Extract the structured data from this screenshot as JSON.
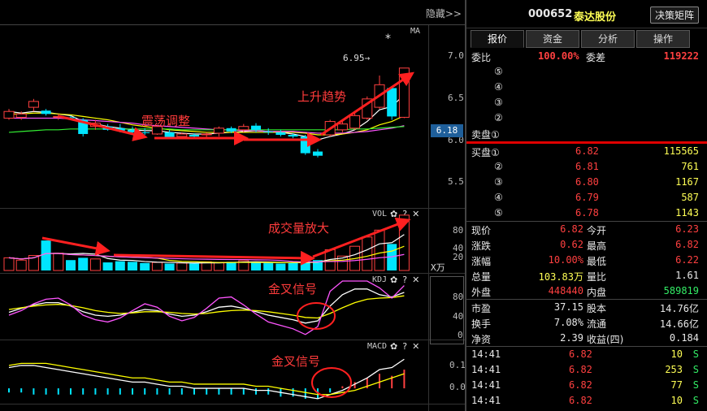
{
  "toolbar": {
    "hide_label": "隐藏>>"
  },
  "main_chart": {
    "ma_label": "MA",
    "star_mark": "*",
    "high_label": "6.95→",
    "price_axis": [
      "7.0",
      "6.5",
      "6.0",
      "5.5"
    ],
    "current_price": "6.18",
    "annotations": {
      "consolidation": "震荡调整",
      "uptrend": "上升趋势"
    }
  },
  "volume_pane": {
    "title": "VOL",
    "axis": [
      "80",
      "40",
      "20"
    ],
    "unit": "X万",
    "annotation": "成交量放大"
  },
  "kdj_pane": {
    "title": "KDJ",
    "axis": [
      "80",
      "40",
      "0"
    ],
    "annotation": "金叉信号"
  },
  "macd_pane": {
    "title": "MACD",
    "axis": [
      "0.1",
      "0.0"
    ],
    "annotation": "金叉信号"
  },
  "pane_icons": {
    "settings": "✿",
    "help": "?",
    "close": "✕"
  },
  "quote": {
    "code": "000652",
    "name": "泰达股份",
    "decision_button": "决策矩阵",
    "tabs": [
      "报价",
      "资金",
      "分析",
      "操作"
    ],
    "weibi_label": "委比",
    "weibi_value": "100.00%",
    "weicha_label": "委差",
    "weicha_value": "119222",
    "sell_levels": [
      {
        "label": "⑤"
      },
      {
        "label": "④"
      },
      {
        "label": "③"
      },
      {
        "label": "②"
      },
      {
        "label": "卖盘①"
      }
    ],
    "buy_levels": [
      {
        "label": "买盘①",
        "price": "6.82",
        "volume": "115565"
      },
      {
        "label": "②",
        "price": "6.81",
        "volume": "761"
      },
      {
        "label": "③",
        "price": "6.80",
        "volume": "1167"
      },
      {
        "label": "④",
        "price": "6.79",
        "volume": "587"
      },
      {
        "label": "⑤",
        "price": "6.78",
        "volume": "1143"
      }
    ],
    "stats": [
      {
        "l1": "现价",
        "v1": "6.82",
        "c1": "red",
        "l2": "今开",
        "v2": "6.23",
        "c2": "red"
      },
      {
        "l1": "涨跌",
        "v1": "0.62",
        "c1": "red",
        "l2": "最高",
        "v2": "6.82",
        "c2": "red"
      },
      {
        "l1": "涨幅",
        "v1": "10.00%",
        "c1": "red",
        "l2": "最低",
        "v2": "6.22",
        "c2": "red"
      },
      {
        "l1": "总量",
        "v1": "103.83万",
        "c1": "yellow",
        "l2": "量比",
        "v2": "1.61",
        "c2": "white"
      },
      {
        "l1": "外盘",
        "v1": "448440",
        "c1": "red",
        "l2": "内盘",
        "v2": "589819",
        "c2": "green"
      },
      {
        "l1": "市盈",
        "v1": "37.15",
        "c1": "white",
        "l2": "股本",
        "v2": "14.76亿",
        "c2": "white"
      },
      {
        "l1": "换手",
        "v1": "7.08%",
        "c1": "white",
        "l2": "流通",
        "v2": "14.66亿",
        "c2": "white"
      },
      {
        "l1": "净资",
        "v1": "2.39",
        "c1": "white",
        "l2": "收益(四)",
        "v2": "0.184",
        "c2": "white"
      }
    ],
    "ticks": [
      {
        "time": "14:41",
        "price": "6.82",
        "volume": "10",
        "side": "S"
      },
      {
        "time": "14:41",
        "price": "6.82",
        "volume": "253",
        "side": "S"
      },
      {
        "time": "14:41",
        "price": "6.82",
        "volume": "77",
        "side": "S"
      },
      {
        "time": "14:41",
        "price": "6.82",
        "volume": "10",
        "side": "S"
      }
    ]
  },
  "colors": {
    "up": "#ff4040",
    "down": "#00e5ff",
    "ma5": "#ffffff",
    "ma10": "#ffff00",
    "ma20": "#ff55ff",
    "ma60": "#33ee33",
    "annot": "#ff2020"
  },
  "chart_data": [
    {
      "type": "candlestick",
      "title": "",
      "ylim": [
        5.3,
        7.1
      ],
      "candles": [
        {
          "o": 6.22,
          "h": 6.33,
          "l": 6.2,
          "c": 6.3
        },
        {
          "o": 6.23,
          "h": 6.3,
          "l": 6.2,
          "c": 6.27
        },
        {
          "o": 6.35,
          "h": 6.45,
          "l": 6.3,
          "c": 6.42
        },
        {
          "o": 6.31,
          "h": 6.33,
          "l": 6.25,
          "c": 6.27
        },
        {
          "o": 6.23,
          "h": 6.27,
          "l": 6.2,
          "c": 6.24
        },
        {
          "o": 6.23,
          "h": 6.25,
          "l": 6.2,
          "c": 6.22
        },
        {
          "o": 6.2,
          "h": 6.22,
          "l": 6.0,
          "c": 6.03
        },
        {
          "o": 6.12,
          "h": 6.2,
          "l": 6.08,
          "c": 6.16
        },
        {
          "o": 6.12,
          "h": 6.15,
          "l": 6.07,
          "c": 6.08
        },
        {
          "o": 6.1,
          "h": 6.15,
          "l": 6.05,
          "c": 6.07
        },
        {
          "o": 6.08,
          "h": 6.12,
          "l": 6.03,
          "c": 6.05
        },
        {
          "o": 6.05,
          "h": 6.1,
          "l": 6.02,
          "c": 6.04
        },
        {
          "o": 6.03,
          "h": 6.14,
          "l": 6.02,
          "c": 6.12
        },
        {
          "o": 6.05,
          "h": 6.08,
          "l": 5.97,
          "c": 5.99
        },
        {
          "o": 6.0,
          "h": 6.05,
          "l": 5.97,
          "c": 6.03
        },
        {
          "o": 6.02,
          "h": 6.04,
          "l": 5.97,
          "c": 6.0
        },
        {
          "o": 6.02,
          "h": 6.05,
          "l": 5.98,
          "c": 6.03
        },
        {
          "o": 6.04,
          "h": 6.12,
          "l": 6.0,
          "c": 6.1
        },
        {
          "o": 6.1,
          "h": 6.12,
          "l": 6.04,
          "c": 6.06
        },
        {
          "o": 6.08,
          "h": 6.15,
          "l": 6.05,
          "c": 6.12
        },
        {
          "o": 6.13,
          "h": 6.16,
          "l": 6.05,
          "c": 6.08
        },
        {
          "o": 6.06,
          "h": 6.1,
          "l": 6.02,
          "c": 6.05
        },
        {
          "o": 6.05,
          "h": 6.08,
          "l": 6.0,
          "c": 6.02
        },
        {
          "o": 6.02,
          "h": 6.04,
          "l": 5.98,
          "c": 6.0
        },
        {
          "o": 6.0,
          "h": 6.02,
          "l": 5.78,
          "c": 5.8
        },
        {
          "o": 5.82,
          "h": 5.85,
          "l": 5.75,
          "c": 5.77
        },
        {
          "o": 6.02,
          "h": 6.2,
          "l": 6.0,
          "c": 6.18
        },
        {
          "o": 6.08,
          "h": 6.2,
          "l": 6.05,
          "c": 6.15
        },
        {
          "o": 6.1,
          "h": 6.3,
          "l": 6.08,
          "c": 6.25
        },
        {
          "o": 6.22,
          "h": 6.48,
          "l": 6.2,
          "c": 6.45
        },
        {
          "o": 6.35,
          "h": 6.73,
          "l": 6.33,
          "c": 6.62
        },
        {
          "o": 6.58,
          "h": 6.6,
          "l": 6.2,
          "c": 6.24
        },
        {
          "o": 6.23,
          "h": 6.82,
          "l": 6.22,
          "c": 6.82
        }
      ],
      "ma_series": [
        {
          "values": [
            6.3,
            6.28,
            6.3,
            6.29,
            6.27,
            6.25,
            6.18,
            6.15,
            6.12,
            6.1,
            6.08,
            6.07,
            6.07,
            6.05,
            6.04,
            6.03,
            6.03,
            6.04,
            6.05,
            6.06,
            6.07,
            6.06,
            6.05,
            6.03,
            6.0,
            5.96,
            6.0,
            6.03,
            6.08,
            6.18,
            6.32,
            6.36,
            6.5
          ]
        },
        {
          "values": [
            6.27,
            6.27,
            6.28,
            6.28,
            6.27,
            6.26,
            6.24,
            6.22,
            6.2,
            6.17,
            6.14,
            6.12,
            6.1,
            6.08,
            6.07,
            6.06,
            6.05,
            6.05,
            6.05,
            6.05,
            6.05,
            6.05,
            6.05,
            6.05,
            6.04,
            6.02,
            6.02,
            6.03,
            6.05,
            6.08,
            6.14,
            6.18,
            6.25
          ]
        },
        {
          "values": [
            6.22,
            6.22,
            6.22,
            6.22,
            6.22,
            6.21,
            6.2,
            6.19,
            6.18,
            6.17,
            6.16,
            6.14,
            6.13,
            6.12,
            6.11,
            6.1,
            6.09,
            6.08,
            6.08,
            6.07,
            6.07,
            6.06,
            6.06,
            6.06,
            6.05,
            6.04,
            6.04,
            6.04,
            6.05,
            6.06,
            6.08,
            6.1,
            6.13
          ]
        },
        {
          "values": [
            6.05,
            6.06,
            6.07,
            6.08,
            6.08,
            6.09,
            6.09,
            6.09,
            6.09,
            6.09,
            6.09,
            6.09,
            6.09,
            6.09,
            6.08,
            6.08,
            6.08,
            6.08,
            6.08,
            6.08,
            6.08,
            6.08,
            6.08,
            6.08,
            6.08,
            6.08,
            6.08,
            6.08,
            6.09,
            6.09,
            6.1,
            6.11,
            6.12
          ]
        }
      ]
    },
    {
      "type": "bar",
      "title": "VOL",
      "ylim": [
        0,
        100
      ],
      "values": [
        22,
        18,
        26,
        52,
        30,
        18,
        22,
        20,
        14,
        16,
        15,
        13,
        14,
        12,
        13,
        12,
        15,
        14,
        15,
        17,
        14,
        13,
        12,
        13,
        16,
        18,
        36,
        25,
        42,
        58,
        70,
        46,
        96
      ]
    },
    {
      "type": "line",
      "title": "KDJ",
      "ylim": [
        0,
        100
      ],
      "series": [
        {
          "values": [
            45,
            52,
            58,
            62,
            62,
            56,
            46,
            40,
            38,
            40,
            45,
            50,
            48,
            42,
            38,
            40,
            46,
            54,
            56,
            52,
            46,
            40,
            36,
            32,
            26,
            30,
            56,
            76,
            86,
            86,
            76,
            72,
            80
          ]
        },
        {
          "values": [
            50,
            53,
            56,
            58,
            59,
            57,
            53,
            48,
            45,
            43,
            44,
            46,
            46,
            45,
            43,
            42,
            43,
            46,
            48,
            49,
            48,
            46,
            43,
            40,
            36,
            35,
            43,
            53,
            62,
            68,
            70,
            71,
            74
          ]
        },
        {
          "values": [
            40,
            48,
            60,
            68,
            70,
            58,
            40,
            32,
            28,
            35,
            48,
            60,
            54,
            38,
            30,
            36,
            52,
            70,
            72,
            58,
            42,
            28,
            22,
            16,
            6,
            20,
            82,
            100,
            100,
            100,
            88,
            70,
            92
          ]
        }
      ]
    },
    {
      "type": "bar",
      "title": "MACD",
      "ylim": [
        -0.07,
        0.18
      ],
      "values": [
        -0.02,
        -0.02,
        -0.03,
        -0.03,
        -0.03,
        -0.03,
        -0.03,
        -0.03,
        -0.03,
        -0.03,
        -0.03,
        -0.03,
        -0.03,
        -0.03,
        -0.03,
        -0.03,
        -0.03,
        -0.03,
        -0.03,
        -0.03,
        -0.03,
        -0.03,
        -0.04,
        -0.04,
        -0.05,
        -0.05,
        -0.02,
        0.01,
        0.03,
        0.05,
        0.07,
        0.06,
        0.09
      ],
      "series": [
        {
          "values": [
            0.1,
            0.11,
            0.11,
            0.1,
            0.09,
            0.08,
            0.07,
            0.06,
            0.05,
            0.04,
            0.03,
            0.03,
            0.02,
            0.01,
            0.01,
            0.0,
            0.0,
            0.0,
            0.0,
            0.0,
            -0.01,
            -0.01,
            -0.02,
            -0.03,
            -0.04,
            -0.05,
            -0.03,
            -0.01,
            0.02,
            0.05,
            0.09,
            0.1,
            0.14
          ]
        },
        {
          "values": [
            0.11,
            0.12,
            0.12,
            0.12,
            0.11,
            0.1,
            0.09,
            0.08,
            0.07,
            0.06,
            0.05,
            0.05,
            0.04,
            0.03,
            0.03,
            0.02,
            0.02,
            0.02,
            0.02,
            0.02,
            0.01,
            0.01,
            0.0,
            -0.01,
            -0.02,
            -0.03,
            -0.03,
            -0.02,
            -0.01,
            0.01,
            0.03,
            0.05,
            0.07
          ]
        }
      ]
    }
  ]
}
